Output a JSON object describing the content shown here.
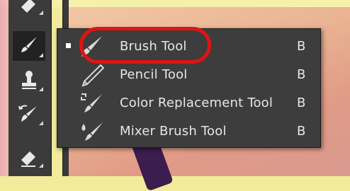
{
  "menu": {
    "items": [
      {
        "label": "Brush Tool",
        "shortcut": "B",
        "icon": "brush-icon",
        "active": true
      },
      {
        "label": "Pencil Tool",
        "shortcut": "B",
        "icon": "pencil-icon",
        "active": false
      },
      {
        "label": "Color Replacement Tool",
        "shortcut": "B",
        "icon": "color-replacement-icon",
        "active": false
      },
      {
        "label": "Mixer Brush Tool",
        "shortcut": "B",
        "icon": "mixer-brush-icon",
        "active": false
      }
    ]
  },
  "toolbar": {
    "tools": [
      "eraser-icon",
      "brush-icon",
      "stamp-icon",
      "history-brush-icon",
      "eraser-icon"
    ]
  },
  "colors": {
    "highlight": "#e11313",
    "menu_bg": "#3d3d3d",
    "toolbar_bg": "#3b3b3b"
  }
}
